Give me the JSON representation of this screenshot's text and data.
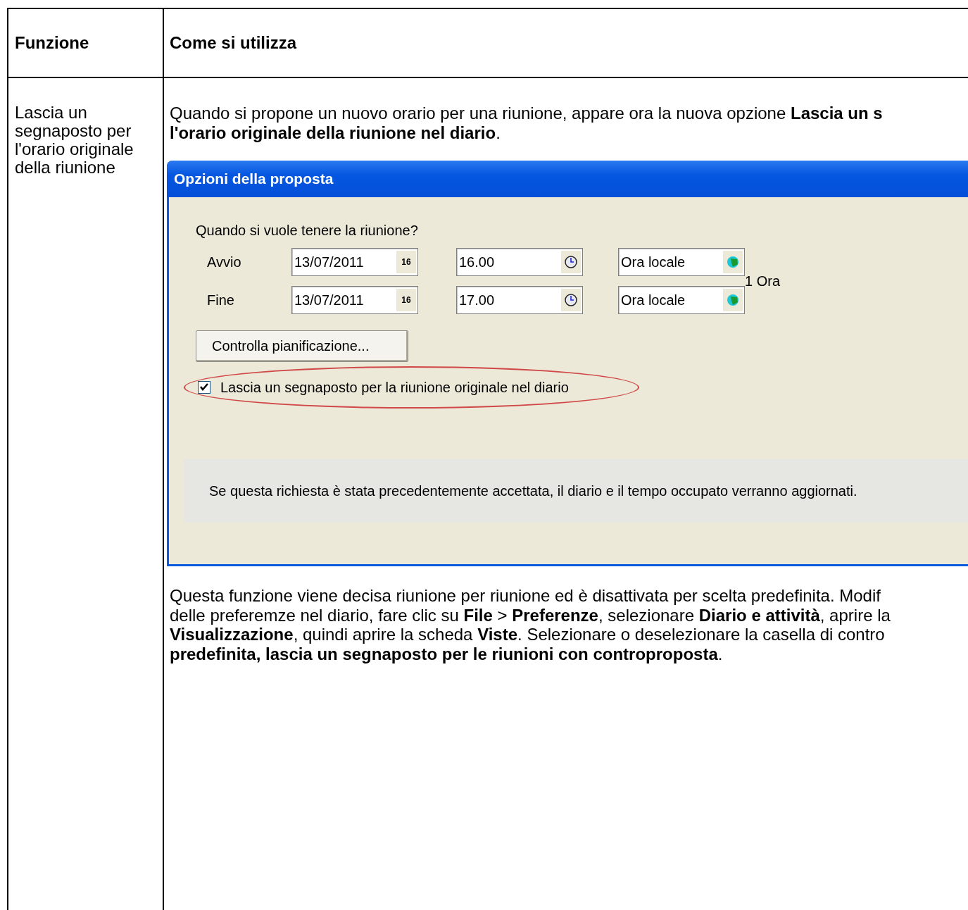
{
  "table": {
    "columns": [
      "Funzione",
      "Come si utilizza"
    ],
    "rows": [
      {
        "feature": "Lascia un segnaposto per l'orario originale della riunione",
        "intro_lines": [
          "Quando si propone un nuovo orario per una riunione, appare ora la nuova opzione **Lascia un s**",
          "**l'orario originale della riunione nel diario**."
        ],
        "dialog": {
          "title": "Opzioni della proposta",
          "question": "Quando si vuole tenere la riunione?",
          "rows": [
            {
              "label": "Avvio",
              "date": "13/07/2011",
              "date_button": "16",
              "time": "16.00",
              "timezone": "Ora locale"
            },
            {
              "label": "Fine",
              "date": "13/07/2011",
              "date_button": "16",
              "time": "17.00",
              "timezone": "Ora locale"
            }
          ],
          "duration": "1 Ora",
          "button": "Controlla pianificazione...",
          "checkbox": {
            "label": "Lascia un segnaposto per la riunione originale nel diario",
            "checked": true
          },
          "info": "Se questa richiesta è stata precedentemente accettata, il diario e il tempo occupato verranno aggiornati."
        },
        "outro_lines": [
          "Questa funzione viene decisa riunione per riunione ed è disattivata per scelta predefinita. Modif",
          "delle preferemze nel diario, fare clic su **File** > **Preferenze**, selezionare **Diario e attività**, aprire la",
          "**Visualizzazione**, quindi aprire la scheda **Viste**. Selezionare o deselezionare la casella di contro",
          "**predefinita, lascia un segnaposto per le riunioni con controproposta**."
        ]
      }
    ]
  }
}
